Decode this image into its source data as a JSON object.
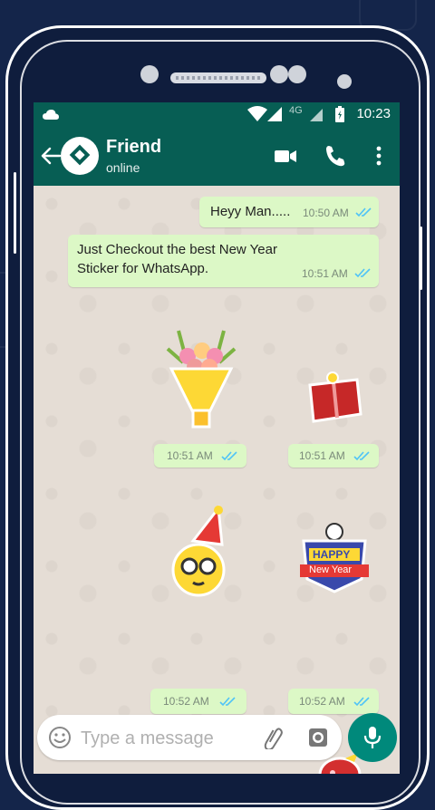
{
  "status_bar": {
    "network": "4G",
    "time": "10:23"
  },
  "header": {
    "contact_name": "Friend",
    "contact_status": "online"
  },
  "messages": [
    {
      "text": "Heyy Man.....",
      "time": "10:50 AM",
      "read": true
    },
    {
      "text_line1": "Just Checkout the best New Year",
      "text_line2": "Sticker for WhatsApp.",
      "time": "10:51 AM",
      "read": true
    }
  ],
  "stickers": [
    {
      "name": "flower-bouquet",
      "time": "10:51 AM"
    },
    {
      "name": "gift-box",
      "time": "10:51 AM"
    },
    {
      "name": "party-emoji",
      "time": "10:52 AM"
    },
    {
      "name": "happy-new-year-badge",
      "time": "10:52 AM",
      "line1": "HAPPY",
      "line2": "New Year"
    },
    {
      "name": "red-gift-bag"
    }
  ],
  "composer": {
    "placeholder": "Type a message"
  },
  "colors": {
    "header": "#075e54",
    "outgoing_bubble": "#dcf8c6",
    "chat_background": "#e5ddd5",
    "mic_button": "#00897b",
    "read_ticks": "#4fc3f7"
  },
  "icons": [
    "back-arrow-icon",
    "video-call-icon",
    "phone-call-icon",
    "more-options-icon",
    "emoji-icon",
    "attach-icon",
    "camera-icon",
    "mic-icon"
  ]
}
